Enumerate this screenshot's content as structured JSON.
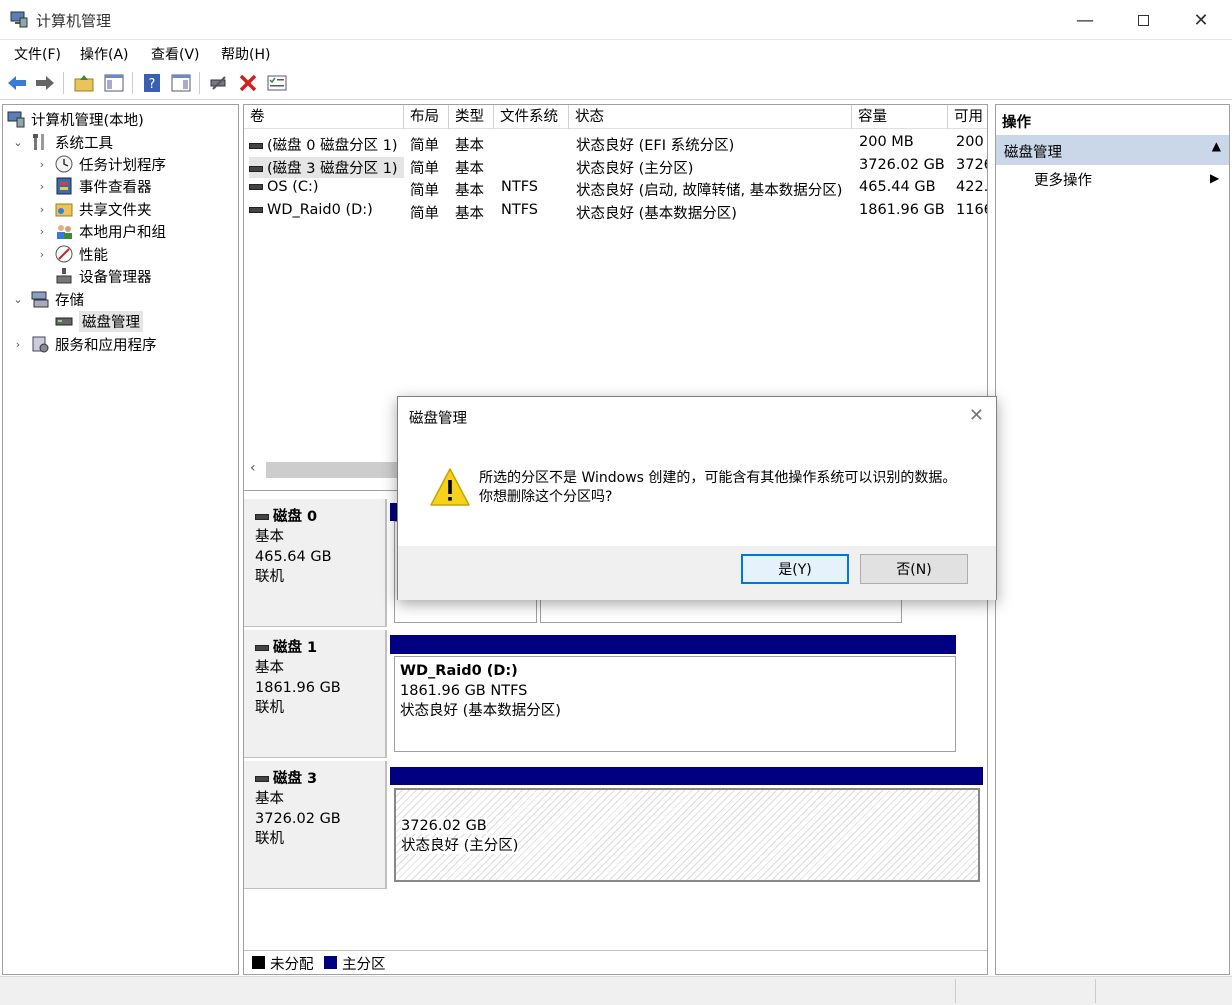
{
  "window": {
    "title": "计算机管理"
  },
  "menu": [
    "文件(F)",
    "操作(A)",
    "查看(V)",
    "帮助(H)"
  ],
  "toolbar": {
    "icons": [
      "back-icon",
      "forward-icon",
      "up-folder-icon",
      "show-hide-tree-icon",
      "help-icon",
      "show-hide-action-icon",
      "connect-icon",
      "delete-icon",
      "properties-icon"
    ]
  },
  "tree": [
    {
      "label": "计算机管理(本地)",
      "icon": "computer-management-icon"
    },
    {
      "label": "系统工具",
      "icon": "tools-icon"
    },
    {
      "label": "任务计划程序",
      "icon": "clock-icon"
    },
    {
      "label": "事件查看器",
      "icon": "event-viewer-icon"
    },
    {
      "label": "共享文件夹",
      "icon": "shared-folder-icon"
    },
    {
      "label": "本地用户和组",
      "icon": "users-icon"
    },
    {
      "label": "性能",
      "icon": "performance-icon"
    },
    {
      "label": "设备管理器",
      "icon": "device-manager-icon"
    },
    {
      "label": "存储",
      "icon": "storage-icon"
    },
    {
      "label": "磁盘管理",
      "icon": "disk-icon"
    },
    {
      "label": "服务和应用程序",
      "icon": "services-icon"
    }
  ],
  "volumes": {
    "columns": [
      "卷",
      "布局",
      "类型",
      "文件系统",
      "状态",
      "容量",
      "可用"
    ],
    "rows": [
      [
        "(磁盘 0 磁盘分区 1)",
        "简单",
        "基本",
        "",
        "状态良好 (EFI 系统分区)",
        "200 MB",
        "200"
      ],
      [
        "(磁盘 3 磁盘分区 1)",
        "简单",
        "基本",
        "",
        "状态良好 (主分区)",
        "3726.02 GB",
        "3726"
      ],
      [
        "OS (C:)",
        "简单",
        "基本",
        "NTFS",
        "状态良好 (启动, 故障转储, 基本数据分区)",
        "465.44 GB",
        "422."
      ],
      [
        "WD_Raid0 (D:)",
        "简单",
        "基本",
        "NTFS",
        "状态良好 (基本数据分区)",
        "1861.96 GB",
        "1166"
      ]
    ]
  },
  "disks": [
    {
      "name": "磁盘 0",
      "type": "基本",
      "size": "465.64 GB",
      "status": "联机"
    },
    {
      "name": "磁盘 1",
      "type": "基本",
      "size": "1861.96 GB",
      "status": "联机",
      "partition": {
        "volume": "WD_Raid0  (D:)",
        "size_fs": "1861.96 GB NTFS",
        "status": "状态良好 (基本数据分区)"
      }
    },
    {
      "name": "磁盘 3",
      "type": "基本",
      "size": "3726.02 GB",
      "status": "联机",
      "partition": {
        "size_fs": "3726.02 GB",
        "status": "状态良好 (主分区)"
      }
    }
  ],
  "legend": [
    {
      "label": "未分配",
      "color": "#000000"
    },
    {
      "label": "主分区",
      "color": "#000080"
    }
  ],
  "actions": {
    "header": "操作",
    "section": "磁盘管理",
    "more": "更多操作"
  },
  "dialog": {
    "title": "磁盘管理",
    "line1": "所选的分区不是 Windows 创建的，可能含有其他操作系统可以识别的数据。",
    "line2": "你想删除这个分区吗?",
    "yes": "是(Y)",
    "no": "否(N)"
  },
  "colors": {
    "primary_partition": "#000080",
    "selection": "#c9d7e8",
    "accent": "#0078d7"
  }
}
